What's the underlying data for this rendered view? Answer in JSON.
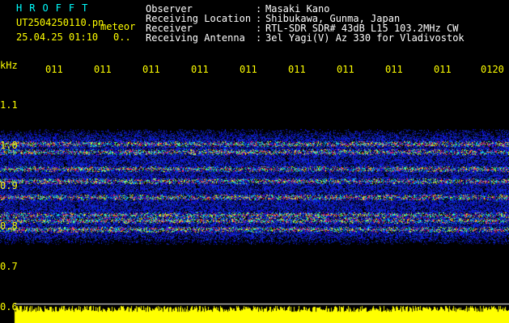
{
  "header": {
    "brand": "HROFFT",
    "filename": "UT2504250110.pn",
    "mode": "meteor",
    "datetime": "25.04.25 01:10",
    "counter": "0..",
    "info_rows": [
      {
        "label": "Observer",
        "sep": ":",
        "value": "Masaki Kano"
      },
      {
        "label": "Receiving Location",
        "sep": ":",
        "value": "Shibukawa, Gunma, Japan"
      },
      {
        "label": "Receiver",
        "sep": ":",
        "value": "RTL-SDR SDR# 43dB L15 103.2MHz CW"
      },
      {
        "label": "Receiving Antenna",
        "sep": ":",
        "value": "3el Yagi(V) Az 330 for Vladivostok"
      }
    ]
  },
  "time_axis": {
    "labels": [
      "011",
      "011",
      "011",
      "011",
      "011",
      "011",
      "011",
      "011",
      "011",
      "0120"
    ]
  },
  "freq_axis": {
    "unit": "kHz",
    "labels": [
      "1.1",
      "1.0",
      "0.9",
      "0.8",
      "0.7",
      "0.6"
    ]
  },
  "spectrogram": {
    "background": "#000000",
    "noise_color": "#1a2cff",
    "echo_colors": [
      "#00e0ff",
      "#40ff80",
      "#ffff00",
      "#ff2060"
    ],
    "level_bar_color": "#ffff00"
  }
}
